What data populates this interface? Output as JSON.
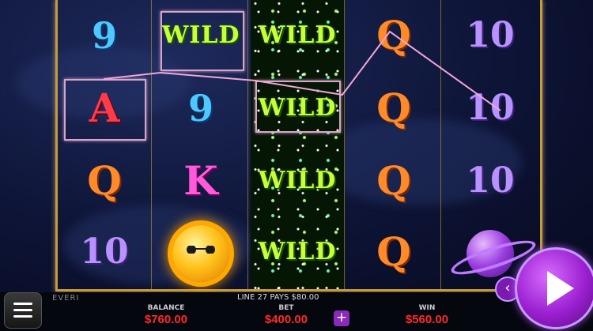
{
  "reels": [
    [
      "9",
      "A",
      "Q",
      "10"
    ],
    [
      "WILD",
      "9",
      "K",
      "sun-symbol"
    ],
    [
      "WILD",
      "WILD",
      "WILD",
      "WILD"
    ],
    [
      "Q",
      "Q",
      "Q",
      "Q"
    ],
    [
      "10",
      "10",
      "10",
      "planet-symbol"
    ]
  ],
  "status": {
    "line_message": "LINE 27 PAYS $80.00"
  },
  "brand": "EVERI",
  "balance": {
    "label": "BALANCE",
    "value": "$760.00"
  },
  "bet": {
    "label": "BET",
    "value": "$400.00",
    "plus_label": "+"
  },
  "win": {
    "label": "WIN",
    "value": "$560.00"
  },
  "controls": {
    "spin_icon": "play-triangle-icon",
    "prev_label": "‹",
    "menu_icon": "hamburger-icon"
  },
  "colors": {
    "accent": "#9a1fd0",
    "gold": "#c79a3a",
    "value_red": "#ff2a2a"
  }
}
